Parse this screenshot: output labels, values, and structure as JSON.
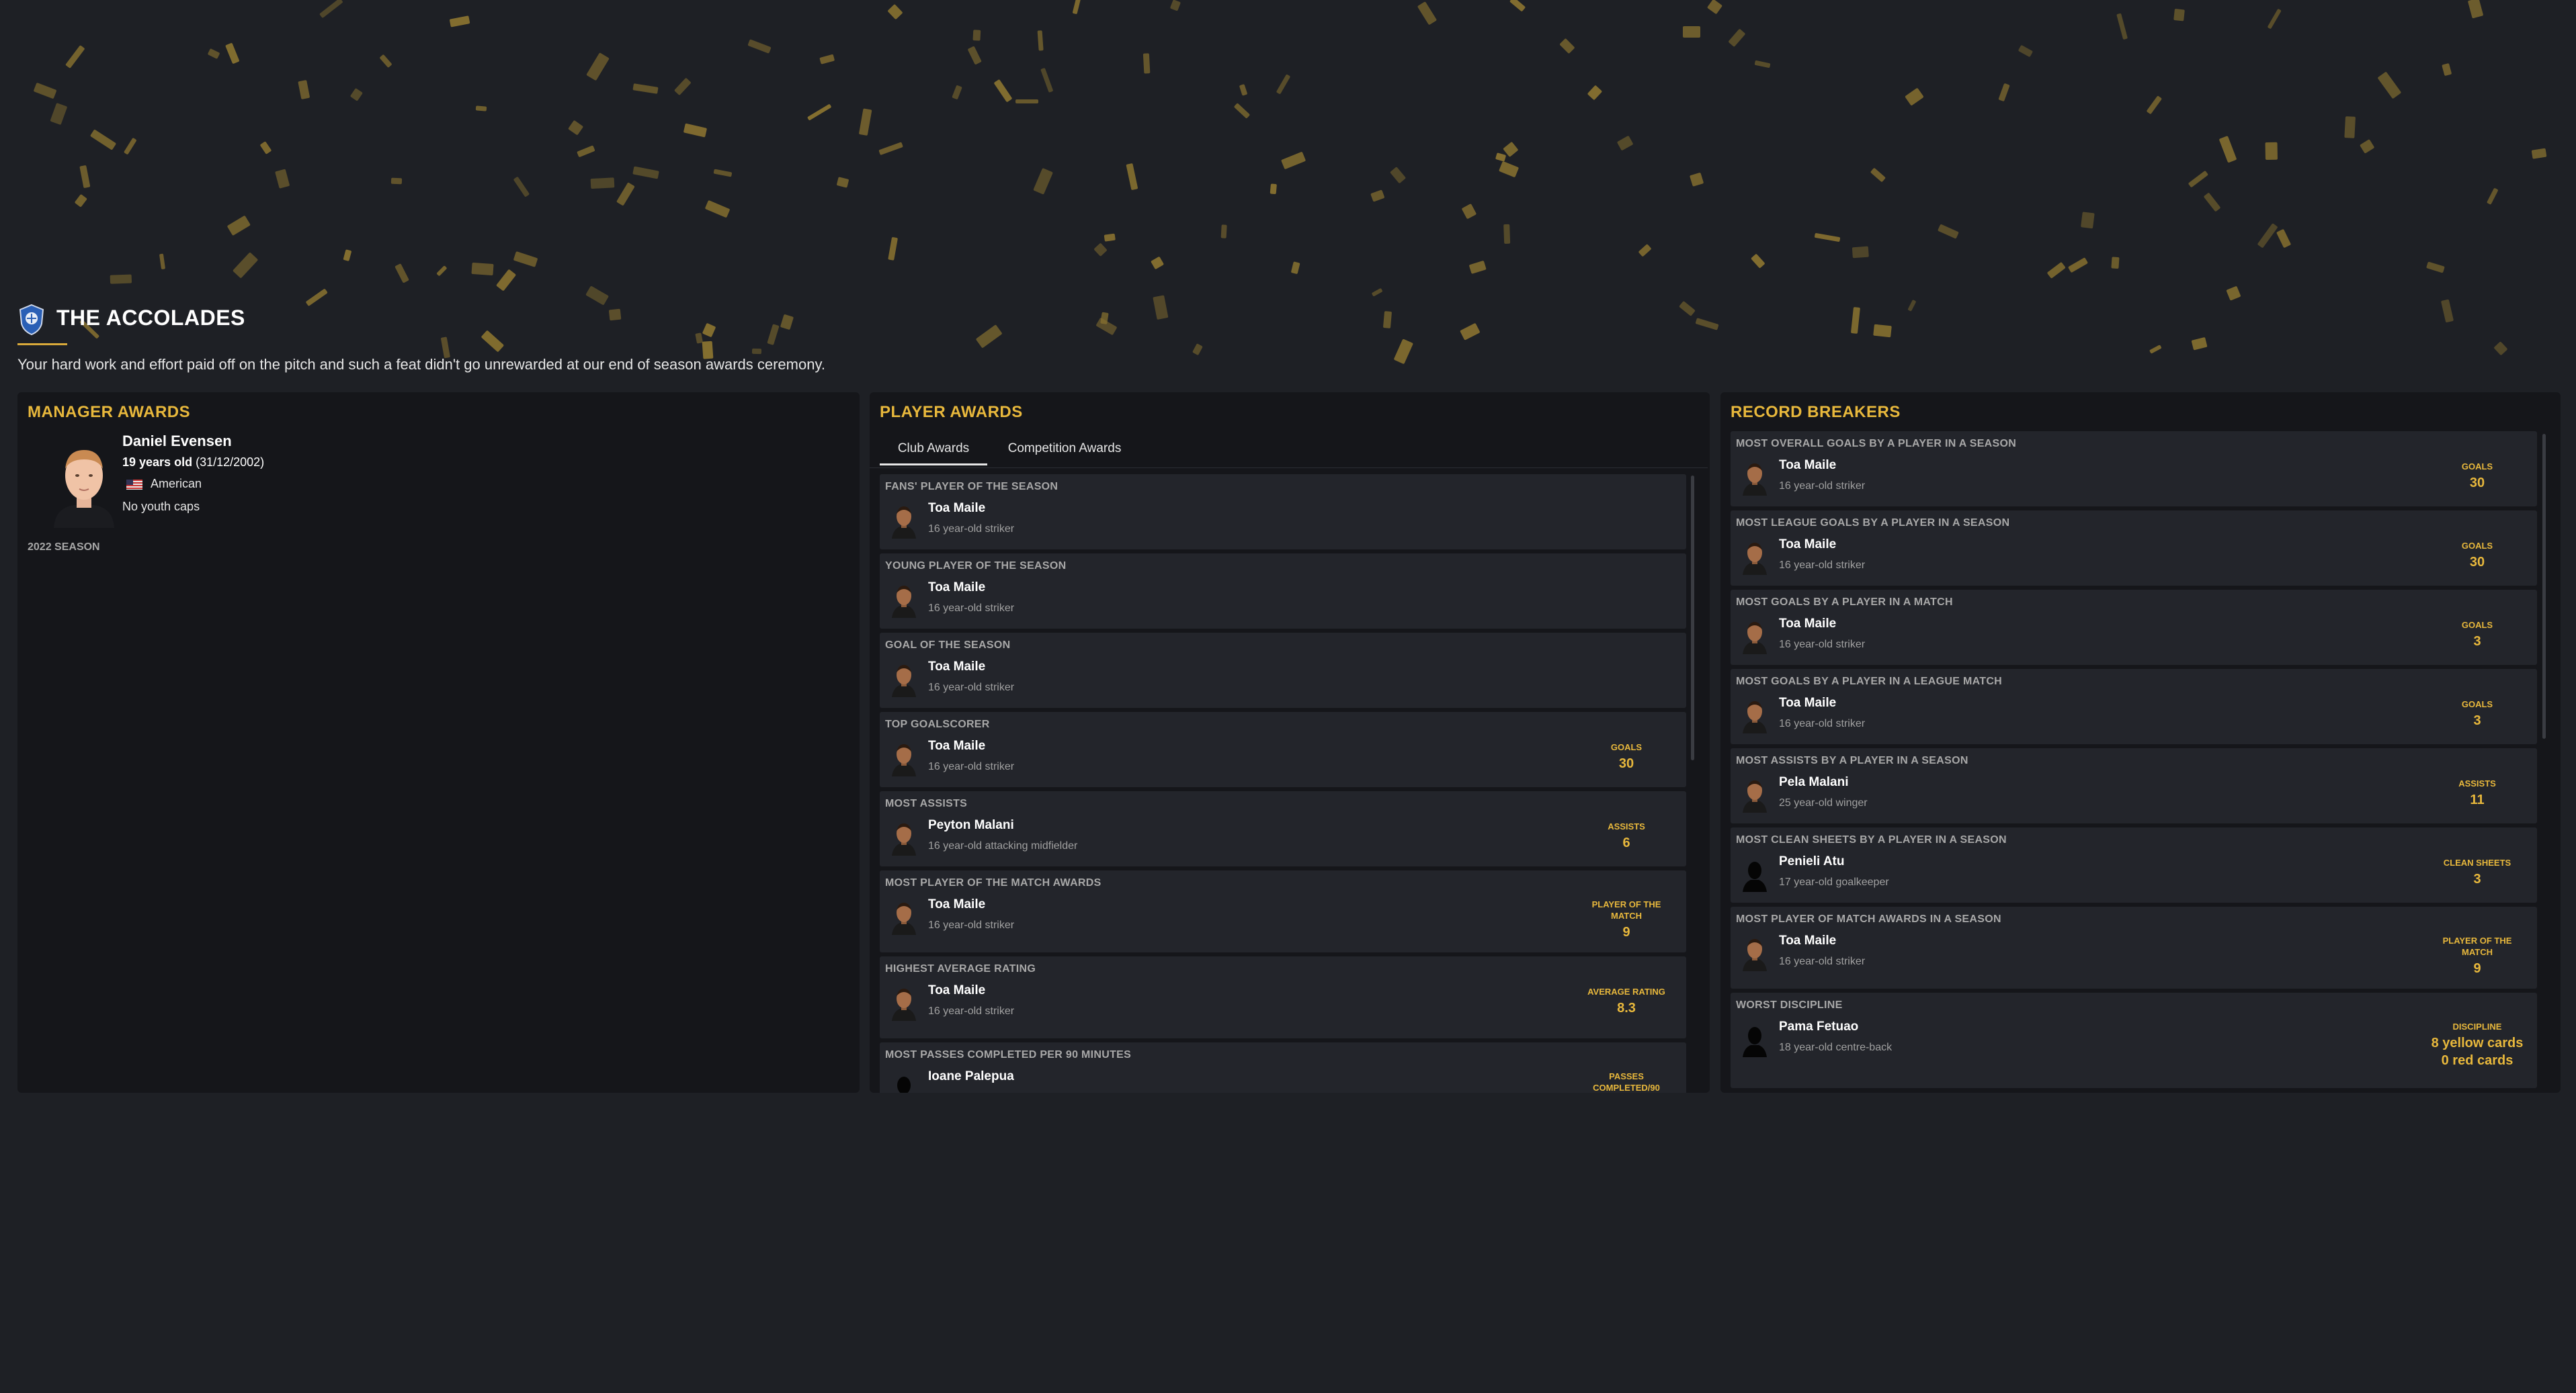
{
  "header": {
    "title": "THE ACCOLADES",
    "intro": "Your hard work and effort paid off on the pitch and such a feat didn't go unrewarded at our end of season awards ceremony."
  },
  "manager_awards": {
    "title": "MANAGER AWARDS",
    "name": "Daniel Evensen",
    "age": "19 years old",
    "dob": "(31/12/2002)",
    "nationality": "American",
    "caps": "No youth caps",
    "season": "2022 SEASON"
  },
  "player_awards": {
    "title": "PLAYER AWARDS",
    "tabs": [
      "Club Awards",
      "Competition Awards"
    ],
    "items": [
      {
        "category": "FANS' PLAYER OF THE SEASON",
        "name": "Toa Maile",
        "desc": "16 year-old striker",
        "stat_label": "",
        "stat_value": ""
      },
      {
        "category": "YOUNG PLAYER OF THE SEASON",
        "name": "Toa Maile",
        "desc": "16 year-old striker",
        "stat_label": "",
        "stat_value": ""
      },
      {
        "category": "GOAL OF THE SEASON",
        "name": "Toa Maile",
        "desc": "16 year-old striker",
        "stat_label": "",
        "stat_value": ""
      },
      {
        "category": "TOP GOALSCORER",
        "name": "Toa Maile",
        "desc": "16 year-old striker",
        "stat_label": "GOALS",
        "stat_value": "30"
      },
      {
        "category": "MOST ASSISTS",
        "name": "Peyton Malani",
        "desc": "16 year-old attacking midfielder",
        "stat_label": "ASSISTS",
        "stat_value": "6"
      },
      {
        "category": "MOST PLAYER OF THE MATCH AWARDS",
        "name": "Toa Maile",
        "desc": "16 year-old striker",
        "stat_label": "PLAYER OF THE MATCH",
        "stat_value": "9"
      },
      {
        "category": "HIGHEST AVERAGE RATING",
        "name": "Toa Maile",
        "desc": "16 year-old striker",
        "stat_label": "AVERAGE RATING",
        "stat_value": "8.3"
      },
      {
        "category": "MOST PASSES COMPLETED PER 90 MINUTES",
        "name": "Ioane Palepua",
        "desc": "",
        "stat_label": "PASSES COMPLETED/90",
        "stat_value": ""
      }
    ]
  },
  "record_breakers": {
    "title": "RECORD BREAKERS",
    "items": [
      {
        "category": "MOST OVERALL GOALS BY A PLAYER IN A SEASON",
        "name": "Toa Maile",
        "desc": "16 year-old striker",
        "stat_label": "GOALS",
        "stat_value": "30"
      },
      {
        "category": "MOST LEAGUE GOALS BY A PLAYER IN A SEASON",
        "name": "Toa Maile",
        "desc": "16 year-old striker",
        "stat_label": "GOALS",
        "stat_value": "30"
      },
      {
        "category": "MOST GOALS BY A PLAYER IN A MATCH",
        "name": "Toa Maile",
        "desc": "16 year-old striker",
        "stat_label": "GOALS",
        "stat_value": "3"
      },
      {
        "category": "MOST GOALS BY A PLAYER IN A LEAGUE MATCH",
        "name": "Toa Maile",
        "desc": "16 year-old striker",
        "stat_label": "GOALS",
        "stat_value": "3"
      },
      {
        "category": "MOST ASSISTS BY A PLAYER IN A SEASON",
        "name": "Pela Malani",
        "desc": "25 year-old winger",
        "stat_label": "ASSISTS",
        "stat_value": "11"
      },
      {
        "category": "MOST CLEAN SHEETS BY A PLAYER IN A SEASON",
        "name": "Penieli Atu",
        "desc": "17 year-old goalkeeper",
        "stat_label": "CLEAN SHEETS",
        "stat_value": "3"
      },
      {
        "category": "MOST PLAYER OF MATCH AWARDS IN A SEASON",
        "name": "Toa Maile",
        "desc": "16 year-old striker",
        "stat_label": "PLAYER OF THE MATCH",
        "stat_value": "9"
      },
      {
        "category": "WORST DISCIPLINE",
        "name": "Pama Fetuao",
        "desc": "18 year-old centre-back",
        "stat_label": "DISCIPLINE",
        "stat_value": "8 yellow cards",
        "stat_value2": "0 red cards"
      }
    ]
  },
  "colors": {
    "accent": "#e8b83c",
    "background": "#1e2025",
    "panel": "#15161a",
    "card": "#23252b",
    "confetti": "#8a7330"
  }
}
